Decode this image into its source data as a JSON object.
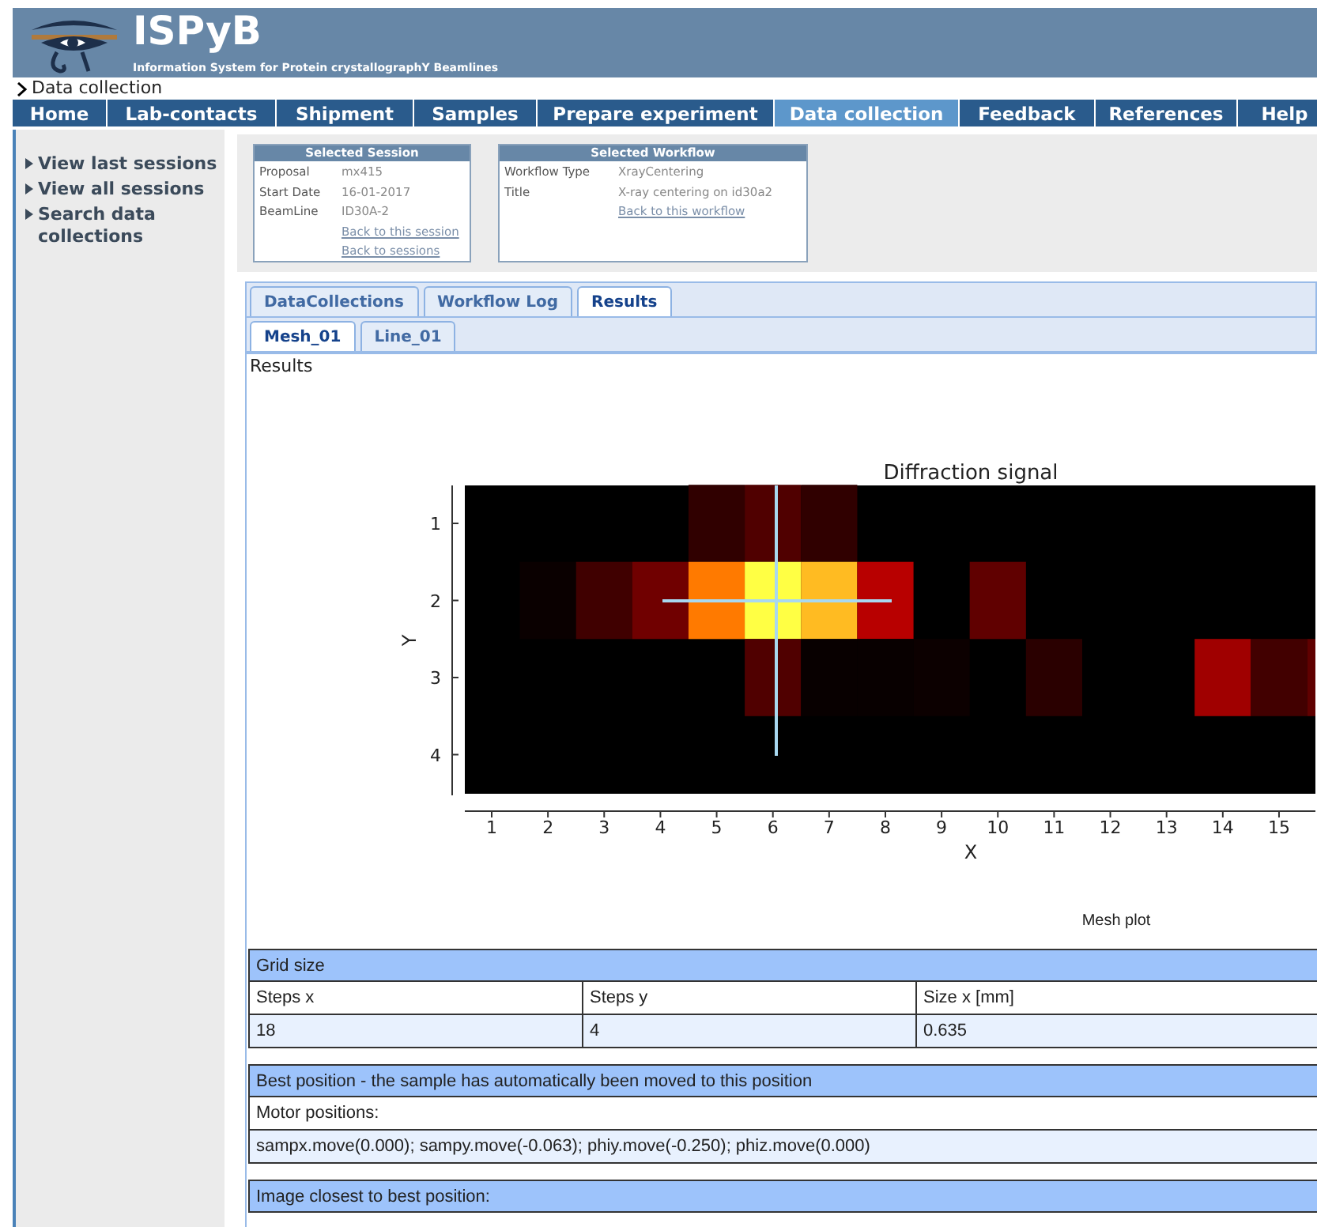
{
  "header": {
    "title": "ISPyB",
    "subtitle": "Information System for Protein crystallographY Beamlines"
  },
  "breadcrumb": "Data collection",
  "nav": [
    {
      "label": "Home",
      "selected": false
    },
    {
      "label": "Lab-contacts",
      "selected": false
    },
    {
      "label": "Shipment",
      "selected": false
    },
    {
      "label": "Samples",
      "selected": false
    },
    {
      "label": "Prepare experiment",
      "selected": false
    },
    {
      "label": "Data collection",
      "selected": true
    },
    {
      "label": "Feedback",
      "selected": false
    },
    {
      "label": "References",
      "selected": false
    },
    {
      "label": "Help",
      "selected": false
    }
  ],
  "sidebar": {
    "items": [
      "View last sessions",
      "View all sessions",
      "Search data collections"
    ]
  },
  "info_boxes": [
    {
      "title": "Selected Session",
      "fields": [
        {
          "label": "Proposal",
          "value": "mx415"
        },
        {
          "label": "Start Date",
          "value": "16-01-2017"
        },
        {
          "label": "BeamLine",
          "value": "ID30A-2"
        }
      ],
      "links": [
        "Back to this session",
        "Back to sessions"
      ]
    },
    {
      "title": "Selected Workflow",
      "fields": [
        {
          "label": "Workflow Type",
          "value": "XrayCentering"
        },
        {
          "label": "Title",
          "value": "X-ray centering on id30a2"
        }
      ],
      "links": [
        "Back to this workflow"
      ]
    }
  ],
  "tabs": [
    {
      "label": "DataCollections",
      "selected": false
    },
    {
      "label": "Workflow Log",
      "selected": false
    },
    {
      "label": "Results",
      "selected": true
    }
  ],
  "subtabs": [
    {
      "label": "Mesh_01",
      "selected": true
    },
    {
      "label": "Line_01",
      "selected": false
    }
  ],
  "results": {
    "label": "Results",
    "plot": {
      "title": "Diffraction signal",
      "xlabel": "X",
      "ylabel": "Y",
      "xticks": [
        "1",
        "2",
        "3",
        "4",
        "5",
        "6",
        "7",
        "8",
        "9",
        "10",
        "11",
        "12",
        "13",
        "14",
        "15"
      ],
      "yticks": [
        "1",
        "2",
        "3",
        "4"
      ],
      "caption": "Mesh plot"
    },
    "tables": [
      {
        "title": "Grid size",
        "rows": [
          {
            "kind": "label",
            "cells": [
              "Steps x",
              "Steps y",
              "Size x [mm]"
            ]
          },
          {
            "kind": "value",
            "cells": [
              "18",
              "4",
              "0.635"
            ]
          }
        ]
      },
      {
        "title": "Best position - the sample has automatically been moved to this position",
        "rows": [
          {
            "kind": "label",
            "cells": [
              "Motor positions:"
            ]
          },
          {
            "kind": "value",
            "cells": [
              "sampx.move(0.000); sampy.move(-0.063); phiy.move(-0.250); phiz.move(0.000)"
            ]
          }
        ]
      },
      {
        "title": "Image closest to best position:"
      }
    ]
  }
}
